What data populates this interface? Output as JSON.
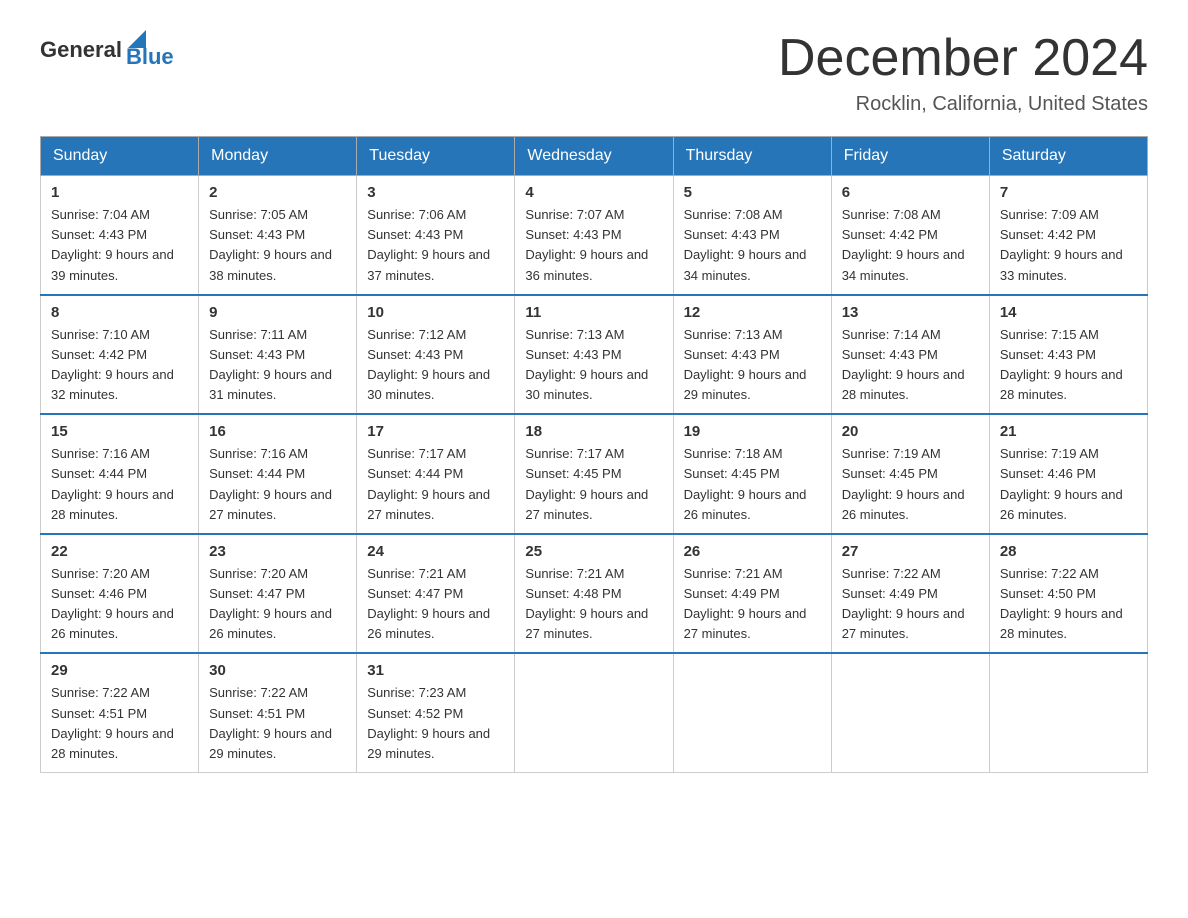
{
  "header": {
    "logo_general": "General",
    "logo_blue": "Blue",
    "month_title": "December 2024",
    "location": "Rocklin, California, United States"
  },
  "weekdays": [
    "Sunday",
    "Monday",
    "Tuesday",
    "Wednesday",
    "Thursday",
    "Friday",
    "Saturday"
  ],
  "weeks": [
    [
      {
        "day": "1",
        "sunrise": "7:04 AM",
        "sunset": "4:43 PM",
        "daylight": "9 hours and 39 minutes."
      },
      {
        "day": "2",
        "sunrise": "7:05 AM",
        "sunset": "4:43 PM",
        "daylight": "9 hours and 38 minutes."
      },
      {
        "day": "3",
        "sunrise": "7:06 AM",
        "sunset": "4:43 PM",
        "daylight": "9 hours and 37 minutes."
      },
      {
        "day": "4",
        "sunrise": "7:07 AM",
        "sunset": "4:43 PM",
        "daylight": "9 hours and 36 minutes."
      },
      {
        "day": "5",
        "sunrise": "7:08 AM",
        "sunset": "4:43 PM",
        "daylight": "9 hours and 34 minutes."
      },
      {
        "day": "6",
        "sunrise": "7:08 AM",
        "sunset": "4:42 PM",
        "daylight": "9 hours and 34 minutes."
      },
      {
        "day": "7",
        "sunrise": "7:09 AM",
        "sunset": "4:42 PM",
        "daylight": "9 hours and 33 minutes."
      }
    ],
    [
      {
        "day": "8",
        "sunrise": "7:10 AM",
        "sunset": "4:42 PM",
        "daylight": "9 hours and 32 minutes."
      },
      {
        "day": "9",
        "sunrise": "7:11 AM",
        "sunset": "4:43 PM",
        "daylight": "9 hours and 31 minutes."
      },
      {
        "day": "10",
        "sunrise": "7:12 AM",
        "sunset": "4:43 PM",
        "daylight": "9 hours and 30 minutes."
      },
      {
        "day": "11",
        "sunrise": "7:13 AM",
        "sunset": "4:43 PM",
        "daylight": "9 hours and 30 minutes."
      },
      {
        "day": "12",
        "sunrise": "7:13 AM",
        "sunset": "4:43 PM",
        "daylight": "9 hours and 29 minutes."
      },
      {
        "day": "13",
        "sunrise": "7:14 AM",
        "sunset": "4:43 PM",
        "daylight": "9 hours and 28 minutes."
      },
      {
        "day": "14",
        "sunrise": "7:15 AM",
        "sunset": "4:43 PM",
        "daylight": "9 hours and 28 minutes."
      }
    ],
    [
      {
        "day": "15",
        "sunrise": "7:16 AM",
        "sunset": "4:44 PM",
        "daylight": "9 hours and 28 minutes."
      },
      {
        "day": "16",
        "sunrise": "7:16 AM",
        "sunset": "4:44 PM",
        "daylight": "9 hours and 27 minutes."
      },
      {
        "day": "17",
        "sunrise": "7:17 AM",
        "sunset": "4:44 PM",
        "daylight": "9 hours and 27 minutes."
      },
      {
        "day": "18",
        "sunrise": "7:17 AM",
        "sunset": "4:45 PM",
        "daylight": "9 hours and 27 minutes."
      },
      {
        "day": "19",
        "sunrise": "7:18 AM",
        "sunset": "4:45 PM",
        "daylight": "9 hours and 26 minutes."
      },
      {
        "day": "20",
        "sunrise": "7:19 AM",
        "sunset": "4:45 PM",
        "daylight": "9 hours and 26 minutes."
      },
      {
        "day": "21",
        "sunrise": "7:19 AM",
        "sunset": "4:46 PM",
        "daylight": "9 hours and 26 minutes."
      }
    ],
    [
      {
        "day": "22",
        "sunrise": "7:20 AM",
        "sunset": "4:46 PM",
        "daylight": "9 hours and 26 minutes."
      },
      {
        "day": "23",
        "sunrise": "7:20 AM",
        "sunset": "4:47 PM",
        "daylight": "9 hours and 26 minutes."
      },
      {
        "day": "24",
        "sunrise": "7:21 AM",
        "sunset": "4:47 PM",
        "daylight": "9 hours and 26 minutes."
      },
      {
        "day": "25",
        "sunrise": "7:21 AM",
        "sunset": "4:48 PM",
        "daylight": "9 hours and 27 minutes."
      },
      {
        "day": "26",
        "sunrise": "7:21 AM",
        "sunset": "4:49 PM",
        "daylight": "9 hours and 27 minutes."
      },
      {
        "day": "27",
        "sunrise": "7:22 AM",
        "sunset": "4:49 PM",
        "daylight": "9 hours and 27 minutes."
      },
      {
        "day": "28",
        "sunrise": "7:22 AM",
        "sunset": "4:50 PM",
        "daylight": "9 hours and 28 minutes."
      }
    ],
    [
      {
        "day": "29",
        "sunrise": "7:22 AM",
        "sunset": "4:51 PM",
        "daylight": "9 hours and 28 minutes."
      },
      {
        "day": "30",
        "sunrise": "7:22 AM",
        "sunset": "4:51 PM",
        "daylight": "9 hours and 29 minutes."
      },
      {
        "day": "31",
        "sunrise": "7:23 AM",
        "sunset": "4:52 PM",
        "daylight": "9 hours and 29 minutes."
      },
      null,
      null,
      null,
      null
    ]
  ],
  "labels": {
    "sunrise_prefix": "Sunrise: ",
    "sunset_prefix": "Sunset: ",
    "daylight_prefix": "Daylight: "
  }
}
